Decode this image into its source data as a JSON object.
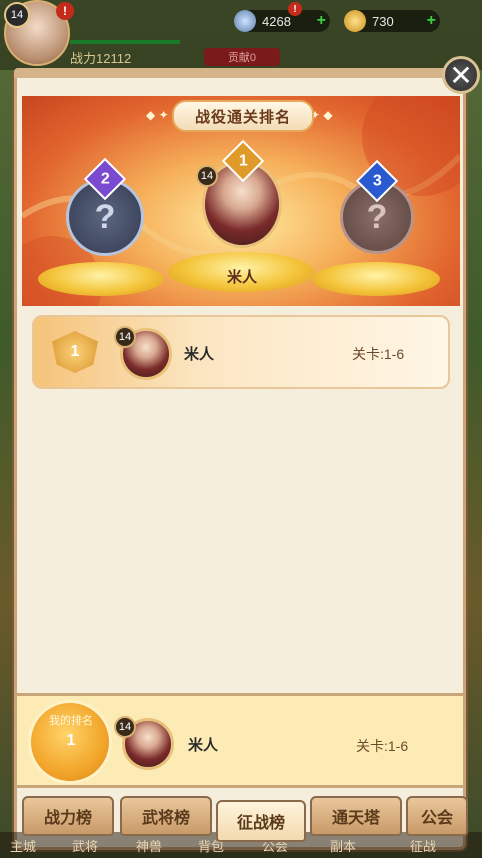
{
  "hud": {
    "level": "14",
    "alert": "!",
    "alert2": "!",
    "currency1": "4268",
    "currency2": "730",
    "power": "战力12112",
    "rank_pill": "贡献0"
  },
  "colors": {
    "accent": "#e8a85a",
    "panel": "#f5eedd",
    "highlight": "#fdebb6"
  },
  "banner": {
    "title": "战役通关排名",
    "deco_left": "◆ ✦",
    "deco_right": "✦ ◆",
    "first": {
      "rank": "1",
      "level": "14",
      "name": "米人"
    },
    "second": {
      "rank": "2",
      "mark": "?"
    },
    "third": {
      "rank": "3",
      "mark": "?"
    }
  },
  "list": [
    {
      "rank": "1",
      "level": "14",
      "name": "米人",
      "stage": "关卡:1-6"
    }
  ],
  "my_rank": {
    "label": "我的排名",
    "rank": "1",
    "level": "14",
    "name": "米人",
    "stage": "关卡:1-6"
  },
  "tabs": [
    "战力榜",
    "武将榜",
    "征战榜",
    "通天塔",
    "公会"
  ],
  "bottom_nav": [
    "主城",
    "武将",
    "神兽",
    "背包",
    "公会",
    "副本",
    "征战"
  ]
}
